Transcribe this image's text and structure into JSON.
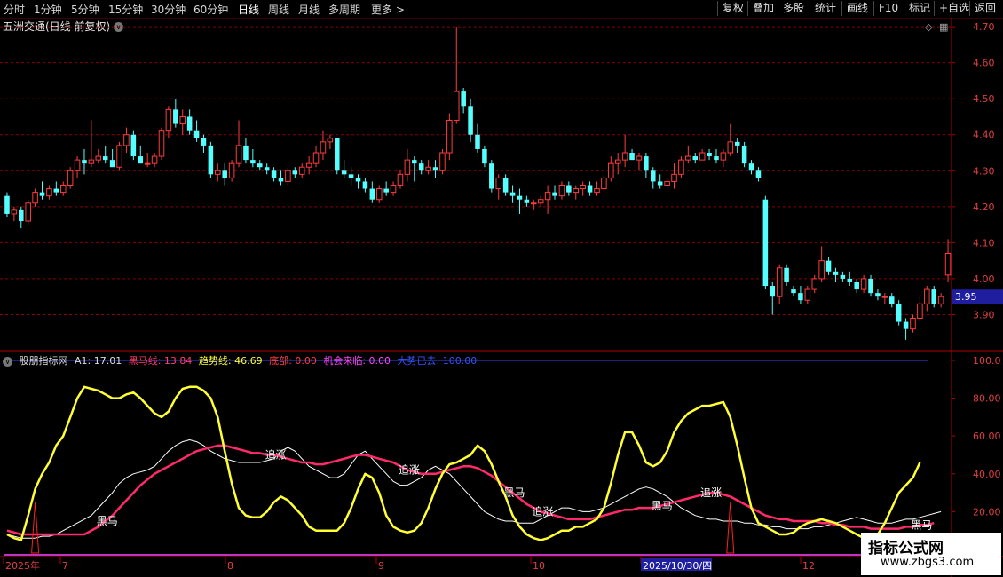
{
  "toolbar": {
    "timeframes": [
      "分时",
      "1分钟",
      "5分钟",
      "15分钟",
      "30分钟",
      "60分钟",
      "日线",
      "周线",
      "月线",
      "多周期",
      "更多"
    ],
    "active_timeframe": "日线",
    "right_buttons": [
      "复权",
      "叠加",
      "多股",
      "统计",
      "画线",
      "F10",
      "标记",
      "+自选",
      "返回"
    ]
  },
  "chart_title": "五洲交通(日线 前复权)",
  "current_price_label": "3.95",
  "price_axis_ticks": [
    "4.70",
    "4.60",
    "4.50",
    "4.40",
    "4.30",
    "4.20",
    "4.10",
    "4.00",
    "3.90"
  ],
  "indicator": {
    "name": "股朋指标网",
    "a1": "A1: 17.01",
    "heima": "黑马线: 13.84",
    "qushi": "趋势线: 46.69",
    "dibu": "底部: 0.00",
    "jihui": "机会来临: 0.00",
    "dashi": "大势已去: 100.00",
    "axis_ticks": [
      "100.0",
      "80.00",
      "60.00",
      "40.00",
      "20.00"
    ],
    "annotations": [
      {
        "text": "黑马",
        "x_index": 14
      },
      {
        "text": "追涨",
        "x_index": 38
      },
      {
        "text": "追涨",
        "x_index": 57
      },
      {
        "text": "黑马",
        "x_index": 72
      },
      {
        "text": "追涨",
        "x_index": 76
      },
      {
        "text": "黑马",
        "x_index": 93
      },
      {
        "text": "追涨",
        "x_index": 100
      },
      {
        "text": "黑马",
        "x_index": 130
      },
      {
        "text": "黑马",
        "x_index": 146
      }
    ]
  },
  "date_axis": {
    "labels": [
      "2025年",
      "7",
      "8",
      "9",
      "10",
      "2025/10/30/四",
      "12"
    ]
  },
  "watermark": {
    "line1": "指标公式网",
    "line2": "www.zbgs3.com"
  },
  "colors": {
    "up": "#ff3c3c",
    "down": "#54ffff",
    "grid": "#8b0000",
    "axis": "#b00000",
    "yellow": "#ffff33",
    "trend": "#ff2a6a",
    "white": "#ffffff",
    "blue": "#3344ff",
    "magenta": "#ff44ff"
  },
  "chart_data": {
    "type": "candlestick",
    "y_range": [
      3.8,
      4.72
    ],
    "ohlc": [
      [
        4.23,
        4.24,
        4.17,
        4.18
      ],
      [
        4.18,
        4.2,
        4.16,
        4.19
      ],
      [
        4.19,
        4.2,
        4.14,
        4.16
      ],
      [
        4.16,
        4.22,
        4.15,
        4.21
      ],
      [
        4.21,
        4.25,
        4.2,
        4.24
      ],
      [
        4.24,
        4.27,
        4.22,
        4.23
      ],
      [
        4.23,
        4.26,
        4.22,
        4.25
      ],
      [
        4.25,
        4.27,
        4.23,
        4.24
      ],
      [
        4.24,
        4.27,
        4.23,
        4.26
      ],
      [
        4.26,
        4.31,
        4.25,
        4.3
      ],
      [
        4.3,
        4.34,
        4.28,
        4.33
      ],
      [
        4.33,
        4.36,
        4.29,
        4.32
      ],
      [
        4.32,
        4.44,
        4.31,
        4.33
      ],
      [
        4.33,
        4.36,
        4.32,
        4.34
      ],
      [
        4.34,
        4.37,
        4.32,
        4.33
      ],
      [
        4.33,
        4.36,
        4.32,
        4.31
      ],
      [
        4.31,
        4.38,
        4.3,
        4.37
      ],
      [
        4.37,
        4.42,
        4.35,
        4.4
      ],
      [
        4.4,
        4.41,
        4.33,
        4.34
      ],
      [
        4.34,
        4.37,
        4.32,
        4.32
      ],
      [
        4.32,
        4.35,
        4.31,
        4.32
      ],
      [
        4.32,
        4.35,
        4.31,
        4.34
      ],
      [
        4.34,
        4.42,
        4.33,
        4.41
      ],
      [
        4.41,
        4.48,
        4.39,
        4.47
      ],
      [
        4.47,
        4.5,
        4.42,
        4.43
      ],
      [
        4.43,
        4.47,
        4.4,
        4.45
      ],
      [
        4.45,
        4.47,
        4.4,
        4.41
      ],
      [
        4.41,
        4.44,
        4.38,
        4.39
      ],
      [
        4.39,
        4.4,
        4.35,
        4.37
      ],
      [
        4.37,
        4.38,
        4.28,
        4.29
      ],
      [
        4.29,
        4.32,
        4.27,
        4.3
      ],
      [
        4.3,
        4.32,
        4.26,
        4.28
      ],
      [
        4.28,
        4.33,
        4.27,
        4.32
      ],
      [
        4.32,
        4.44,
        4.31,
        4.37
      ],
      [
        4.37,
        4.39,
        4.32,
        4.33
      ],
      [
        4.33,
        4.36,
        4.31,
        4.32
      ],
      [
        4.32,
        4.33,
        4.3,
        4.31
      ],
      [
        4.31,
        4.32,
        4.29,
        4.3
      ],
      [
        4.3,
        4.31,
        4.27,
        4.28
      ],
      [
        4.28,
        4.3,
        4.26,
        4.27
      ],
      [
        4.27,
        4.31,
        4.26,
        4.3
      ],
      [
        4.3,
        4.31,
        4.28,
        4.29
      ],
      [
        4.29,
        4.32,
        4.28,
        4.31
      ],
      [
        4.31,
        4.34,
        4.29,
        4.32
      ],
      [
        4.32,
        4.37,
        4.31,
        4.35
      ],
      [
        4.35,
        4.41,
        4.33,
        4.38
      ],
      [
        4.38,
        4.4,
        4.36,
        4.39
      ],
      [
        4.39,
        4.39,
        4.29,
        4.3
      ],
      [
        4.3,
        4.33,
        4.28,
        4.29
      ],
      [
        4.29,
        4.31,
        4.26,
        4.28
      ],
      [
        4.28,
        4.29,
        4.25,
        4.27
      ],
      [
        4.27,
        4.28,
        4.24,
        4.25
      ],
      [
        4.25,
        4.27,
        4.21,
        4.22
      ],
      [
        4.22,
        4.26,
        4.21,
        4.25
      ],
      [
        4.25,
        4.27,
        4.23,
        4.24
      ],
      [
        4.24,
        4.27,
        4.23,
        4.26
      ],
      [
        4.26,
        4.3,
        4.25,
        4.29
      ],
      [
        4.29,
        4.36,
        4.27,
        4.33
      ],
      [
        4.33,
        4.34,
        4.27,
        4.32
      ],
      [
        4.32,
        4.33,
        4.29,
        4.3
      ],
      [
        4.3,
        4.33,
        4.29,
        4.31
      ],
      [
        4.31,
        4.33,
        4.28,
        4.3
      ],
      [
        4.3,
        4.36,
        4.29,
        4.35
      ],
      [
        4.35,
        4.46,
        4.33,
        4.44
      ],
      [
        4.44,
        4.7,
        4.43,
        4.52
      ],
      [
        4.52,
        4.53,
        4.46,
        4.48
      ],
      [
        4.48,
        4.5,
        4.38,
        4.4
      ],
      [
        4.4,
        4.43,
        4.35,
        4.36
      ],
      [
        4.36,
        4.37,
        4.31,
        4.32
      ],
      [
        4.32,
        4.33,
        4.24,
        4.25
      ],
      [
        4.25,
        4.29,
        4.22,
        4.28
      ],
      [
        4.28,
        4.29,
        4.23,
        4.24
      ],
      [
        4.24,
        4.26,
        4.21,
        4.23
      ],
      [
        4.23,
        4.25,
        4.18,
        4.22
      ],
      [
        4.22,
        4.23,
        4.2,
        4.21
      ],
      [
        4.21,
        4.22,
        4.19,
        4.21
      ],
      [
        4.21,
        4.23,
        4.2,
        4.22
      ],
      [
        4.22,
        4.26,
        4.18,
        4.24
      ],
      [
        4.24,
        4.26,
        4.22,
        4.23
      ],
      [
        4.23,
        4.27,
        4.22,
        4.26
      ],
      [
        4.26,
        4.27,
        4.23,
        4.24
      ],
      [
        4.24,
        4.26,
        4.22,
        4.25
      ],
      [
        4.25,
        4.27,
        4.23,
        4.26
      ],
      [
        4.26,
        4.27,
        4.23,
        4.24
      ],
      [
        4.24,
        4.27,
        4.23,
        4.25
      ],
      [
        4.25,
        4.29,
        4.24,
        4.28
      ],
      [
        4.28,
        4.34,
        4.27,
        4.32
      ],
      [
        4.32,
        4.35,
        4.29,
        4.33
      ],
      [
        4.33,
        4.4,
        4.31,
        4.35
      ],
      [
        4.35,
        4.36,
        4.33,
        4.33
      ],
      [
        4.33,
        4.35,
        4.3,
        4.34
      ],
      [
        4.34,
        4.35,
        4.28,
        4.3
      ],
      [
        4.3,
        4.31,
        4.25,
        4.27
      ],
      [
        4.27,
        4.29,
        4.25,
        4.26
      ],
      [
        4.26,
        4.28,
        4.25,
        4.27
      ],
      [
        4.27,
        4.32,
        4.25,
        4.29
      ],
      [
        4.29,
        4.34,
        4.28,
        4.33
      ],
      [
        4.33,
        4.37,
        4.32,
        4.34
      ],
      [
        4.34,
        4.35,
        4.32,
        4.33
      ],
      [
        4.33,
        4.36,
        4.33,
        4.35
      ],
      [
        4.35,
        4.36,
        4.33,
        4.34
      ],
      [
        4.34,
        4.36,
        4.32,
        4.33
      ],
      [
        4.33,
        4.36,
        4.31,
        4.35
      ],
      [
        4.35,
        4.43,
        4.34,
        4.38
      ],
      [
        4.38,
        4.39,
        4.35,
        4.37
      ],
      [
        4.37,
        4.38,
        4.31,
        4.32
      ],
      [
        4.32,
        4.33,
        4.29,
        4.3
      ],
      [
        4.3,
        4.31,
        4.27,
        4.28
      ],
      [
        4.22,
        4.23,
        3.97,
        3.98
      ],
      [
        3.98,
        3.99,
        3.9,
        3.95
      ],
      [
        3.95,
        4.04,
        3.93,
        4.03
      ],
      [
        4.03,
        4.04,
        3.98,
        3.99
      ],
      [
        3.97,
        3.98,
        3.95,
        3.96
      ],
      [
        3.96,
        3.98,
        3.93,
        3.94
      ],
      [
        3.94,
        3.98,
        3.93,
        3.97
      ],
      [
        3.97,
        4.01,
        3.96,
        4.0
      ],
      [
        4.0,
        4.09,
        3.99,
        4.05
      ],
      [
        4.05,
        4.06,
        4.01,
        4.02
      ],
      [
        4.02,
        4.03,
        3.99,
        4.01
      ],
      [
        4.01,
        4.02,
        3.99,
        4.0
      ],
      [
        4.0,
        4.02,
        3.98,
        3.99
      ],
      [
        3.99,
        4.0,
        3.96,
        3.97
      ],
      [
        3.97,
        4.01,
        3.96,
        4.0
      ],
      [
        4.0,
        4.01,
        3.95,
        3.96
      ],
      [
        3.96,
        3.97,
        3.94,
        3.95
      ],
      [
        3.95,
        3.96,
        3.93,
        3.95
      ],
      [
        3.95,
        3.96,
        3.92,
        3.93
      ],
      [
        3.93,
        3.94,
        3.87,
        3.88
      ],
      [
        3.88,
        3.89,
        3.83,
        3.86
      ],
      [
        3.86,
        3.9,
        3.85,
        3.89
      ],
      [
        3.89,
        3.95,
        3.88,
        3.93
      ],
      [
        3.93,
        3.98,
        3.91,
        3.97
      ],
      [
        3.97,
        3.98,
        3.92,
        3.93
      ],
      [
        3.93,
        3.96,
        3.92,
        3.95
      ],
      [
        4.01,
        4.11,
        3.99,
        4.07
      ]
    ],
    "yellow": [
      8,
      6,
      5,
      18,
      32,
      40,
      46,
      55,
      60,
      70,
      80,
      86,
      85,
      84,
      82,
      80,
      80,
      82,
      83,
      80,
      76,
      72,
      70,
      73,
      80,
      85,
      86,
      86,
      84,
      80,
      70,
      52,
      35,
      22,
      18,
      17,
      17,
      20,
      25,
      28,
      26,
      22,
      18,
      12,
      10,
      10,
      10,
      10,
      14,
      22,
      32,
      40,
      38,
      30,
      18,
      12,
      10,
      9,
      10,
      14,
      22,
      32,
      40,
      45,
      46,
      48,
      50,
      55,
      52,
      45,
      36,
      28,
      18,
      12,
      8,
      6,
      5,
      6,
      8,
      10,
      10,
      12,
      12,
      14,
      16,
      22,
      35,
      50,
      62,
      62,
      55,
      46,
      44,
      46,
      52,
      62,
      68,
      72,
      74,
      76,
      76,
      77,
      78,
      70,
      55,
      38,
      22,
      14,
      12,
      10,
      8,
      8,
      9,
      12,
      14,
      15,
      16,
      15,
      14,
      12,
      10,
      8,
      6,
      6,
      8,
      14,
      22,
      30,
      34,
      38,
      46
    ],
    "trend": [
      10,
      9,
      8,
      8,
      8,
      8,
      8,
      8,
      8,
      8,
      8,
      8,
      10,
      12,
      15,
      18,
      22,
      26,
      30,
      34,
      37,
      40,
      42,
      44,
      46,
      48,
      50,
      52,
      53,
      54,
      55,
      55,
      54,
      53,
      52,
      51,
      51,
      50,
      50,
      49,
      48,
      47,
      46,
      46,
      45,
      45,
      46,
      47,
      48,
      49,
      50,
      50,
      49,
      48,
      47,
      46,
      44,
      42,
      41,
      40,
      40,
      40,
      41,
      42,
      43,
      44,
      44,
      43,
      41,
      39,
      36,
      33,
      30,
      27,
      24,
      22,
      20,
      19,
      18,
      17,
      16,
      16,
      16,
      16,
      17,
      18,
      19,
      20,
      21,
      21,
      22,
      22,
      22,
      23,
      24,
      25,
      26,
      27,
      28,
      29,
      30,
      30,
      29,
      28,
      26,
      24,
      22,
      20,
      18,
      17,
      16,
      16,
      15,
      15,
      15,
      15,
      14,
      14,
      13,
      13,
      12,
      12,
      12,
      11,
      11,
      11,
      11,
      11,
      12,
      12,
      13,
      13,
      14
    ],
    "white": [
      8,
      7,
      6,
      6,
      6,
      7,
      7,
      8,
      10,
      12,
      14,
      16,
      18,
      22,
      26,
      30,
      35,
      38,
      40,
      41,
      42,
      44,
      48,
      52,
      55,
      57,
      58,
      57,
      55,
      52,
      50,
      48,
      47,
      46,
      46,
      46,
      46,
      47,
      48,
      52,
      54,
      52,
      48,
      44,
      42,
      40,
      38,
      38,
      40,
      45,
      50,
      52,
      48,
      44,
      40,
      36,
      34,
      34,
      36,
      38,
      42,
      44,
      42,
      40,
      36,
      32,
      28,
      24,
      20,
      18,
      16,
      15,
      15,
      14,
      14,
      14,
      16,
      18,
      20,
      22,
      22,
      21,
      20,
      20,
      21,
      22,
      24,
      26,
      28,
      30,
      32,
      33,
      32,
      30,
      28,
      25,
      22,
      20,
      18,
      17,
      16,
      16,
      15,
      15,
      15,
      14,
      14,
      13,
      13,
      12,
      12,
      11,
      11,
      11,
      11,
      12,
      12,
      13,
      14,
      15,
      16,
      17,
      16,
      15,
      14,
      14,
      14,
      15,
      16,
      16,
      17,
      18,
      19,
      20
    ],
    "red_spikes": [
      4,
      103
    ],
    "indicator_range": [
      0,
      100
    ]
  }
}
